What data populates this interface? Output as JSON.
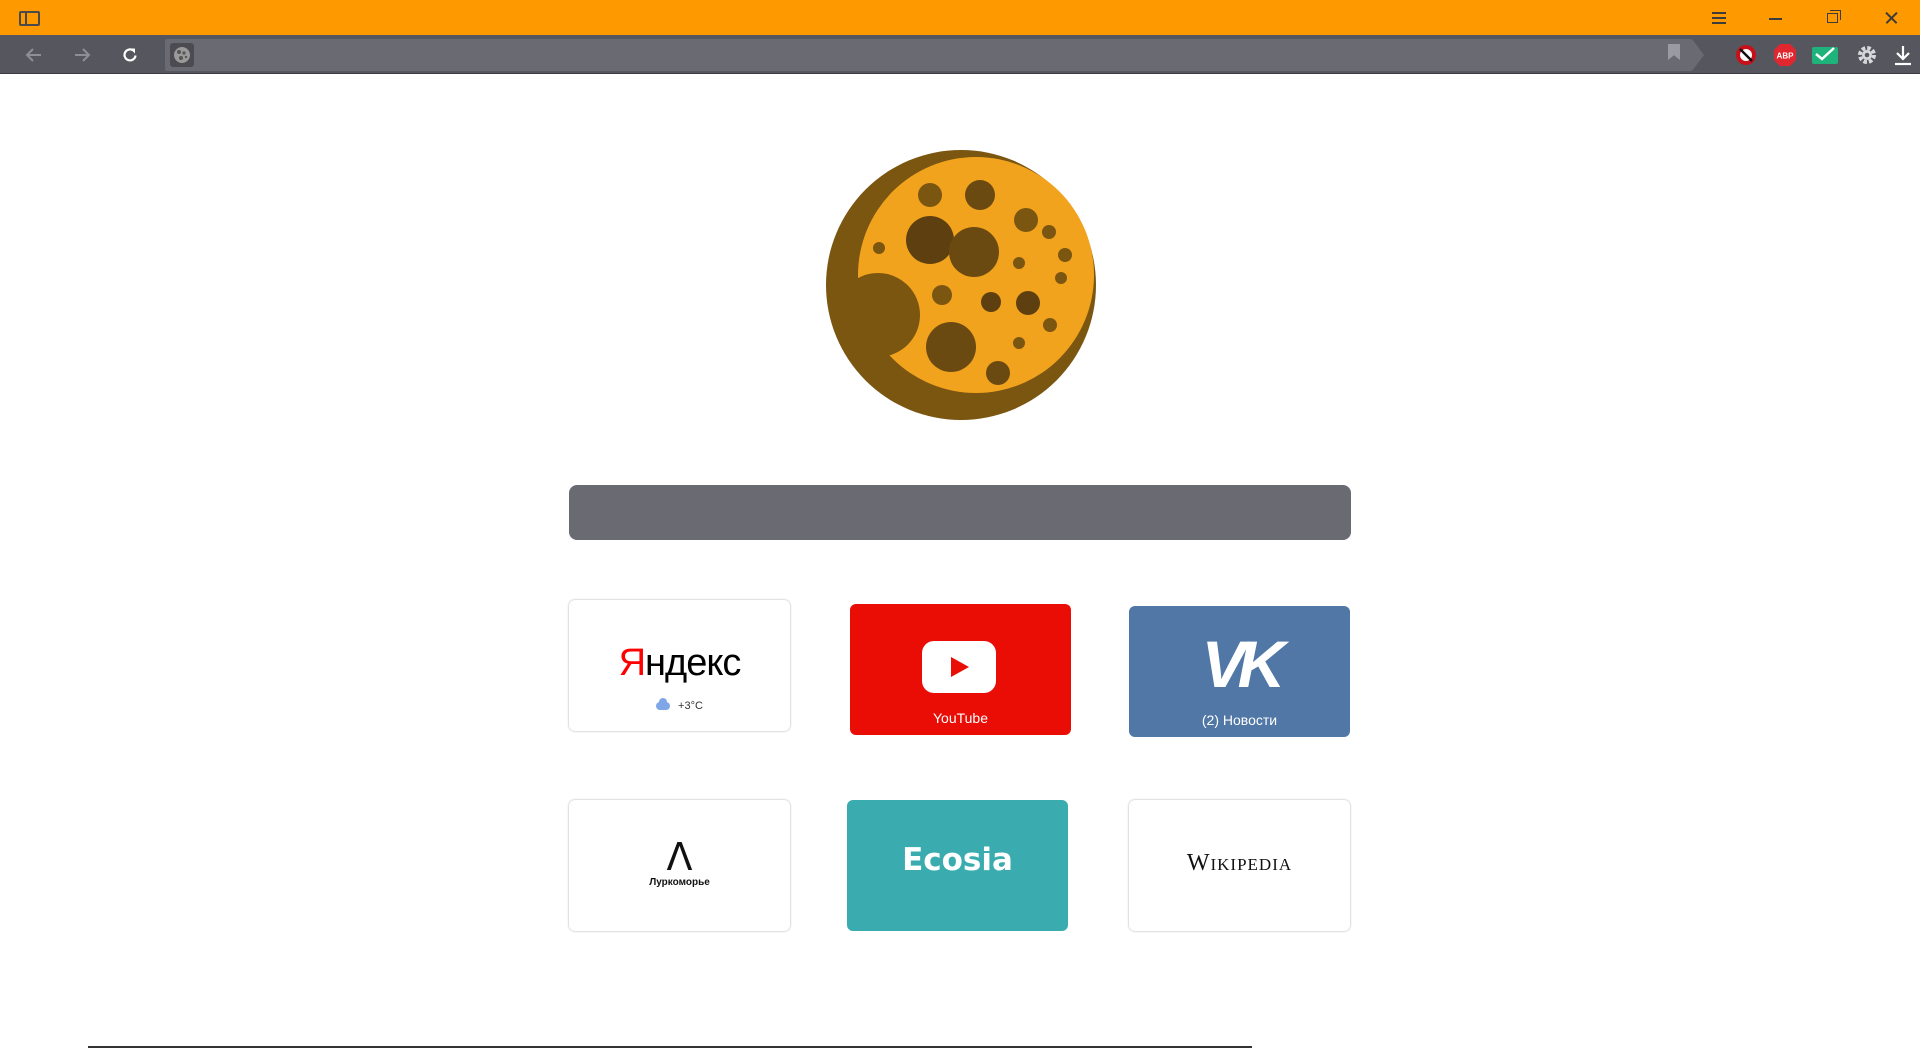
{
  "window": {
    "titlebar_color": "#fe9a00",
    "icons": [
      "sidebar-icon",
      "menu-icon",
      "minimize-icon",
      "restore-icon",
      "close-icon"
    ]
  },
  "toolbar": {
    "back_icon": "back-arrow-icon",
    "forward_icon": "forward-arrow-icon",
    "reload_icon": "reload-icon",
    "address_value": "",
    "extensions": [
      "ublock-icon",
      "adblock-plus-icon",
      "mail-checker-icon",
      "settings-icon",
      "download-icon"
    ],
    "adblock_label": "ABP"
  },
  "search": {
    "placeholder": ""
  },
  "speed_dial": [
    {
      "name": "Яндекс",
      "logo_part1": "Я",
      "logo_part2": "ндекс",
      "weather": "+3°C"
    },
    {
      "name": "YouTube",
      "label": "YouTube",
      "color": "#e90d05"
    },
    {
      "name": "VK",
      "logo": "VK",
      "label": "(2) Новости",
      "color": "#5177a6"
    },
    {
      "name": "Луркоморье",
      "logo": "Λ",
      "label": "Луркоморье"
    },
    {
      "name": "Ecosia",
      "label": "Ecosia",
      "color": "#3aacb0"
    },
    {
      "name": "Wikipedia",
      "label": "Wikipedia"
    }
  ]
}
